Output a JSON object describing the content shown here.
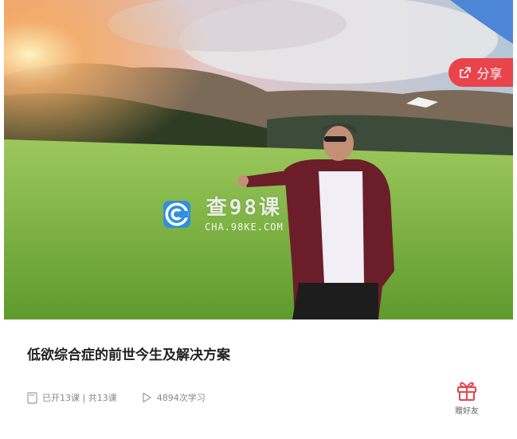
{
  "hero": {
    "image_description_icon": "landscape-photo"
  },
  "share": {
    "label": "分享",
    "icon": "share-icon"
  },
  "watermark": {
    "main": "查98课",
    "sub": "CHA.98KE.COM"
  },
  "course": {
    "title": "低欲综合症的前世今生及解决方案",
    "lessons": "已开13课 | 共13课",
    "views": "4894次学习"
  },
  "gift": {
    "label": "赠好友",
    "icon": "gift-icon"
  },
  "colors": {
    "accent": "#e9434c",
    "watermark_blue": "#2f8fe0"
  }
}
